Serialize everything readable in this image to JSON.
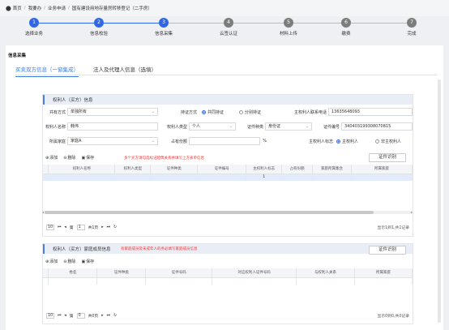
{
  "breadcrumb": {
    "items": [
      "首页",
      "我要办",
      "业务申请",
      "国有建设用地存量房转移登记（二手房）"
    ]
  },
  "steps": [
    {
      "num": "1",
      "label": "选择业务",
      "state": "active"
    },
    {
      "num": "2",
      "label": "信息校验",
      "state": "active"
    },
    {
      "num": "3",
      "label": "信息采集",
      "state": "active"
    },
    {
      "num": "4",
      "label": "云签认证",
      "state": "todo"
    },
    {
      "num": "5",
      "label": "材料上传",
      "state": "todo"
    },
    {
      "num": "6",
      "label": "缴费",
      "state": "todo"
    },
    {
      "num": "7",
      "label": "完成",
      "state": "todo"
    }
  ],
  "section_title": "信息采集",
  "tabs": [
    "买卖双方信息（一窗集成）",
    "法人及代理人信息（选填）"
  ],
  "rights_panel": {
    "title": "权利人（买方）信息",
    "fields": {
      "gongyou_label": "共有方式",
      "gongyou_value": "单独所有",
      "biaoding_label": "持证方式",
      "biaoding_opt1": "共同持证",
      "biaoding_opt2": "分别持证",
      "phone_label": "主权利人联系电话",
      "phone_value": "13635648093",
      "name_label": "权利人名称",
      "name_value": "韩伟",
      "type_label": "权利人类型",
      "type_value": "个人",
      "idtype_label": "证件种类",
      "idtype_value": "身份证",
      "idnum_label": "证件编号",
      "idnum_value": "340403199308070815",
      "area_label": "所属家庭",
      "area_value": "家庭A",
      "share_label": "占有份额",
      "share_value": "",
      "share_unit": "%",
      "main_label": "主权利人标志",
      "main_opt1": "主权利人",
      "main_opt2": "非主权利人"
    },
    "toolbar": {
      "add": "添加",
      "delete": "删除",
      "save": "保存"
    },
    "hint": "多个买方请勾选标记配偶关系并填写上方表单信息",
    "id_button": "证件识别",
    "columns": [
      "权利人名称",
      "权利人类型",
      "证件种类",
      "证件编号",
      "主权利人标志",
      "占有份额",
      "家庭所属集合",
      "所属家庭"
    ],
    "rows": [
      [
        "",
        "",
        "",
        "",
        "1",
        "",
        "",
        ""
      ]
    ],
    "pager": {
      "size": "10",
      "page": "1",
      "total_pages": "共1页",
      "info": "显示1到1,共1记录"
    }
  },
  "family_panel": {
    "title": "权利人（买方）家庭成员信息",
    "hint": "有家庭成员及未成年人的务必填写家庭成员信息",
    "toolbar": {
      "add": "添加",
      "delete": "删除",
      "save": "保存"
    },
    "id_button": "证件识别",
    "columns": [
      "姓名",
      "证件种类",
      "证件号码",
      "对应权利人证件号码",
      "与权利人关系",
      "所属家庭"
    ],
    "pager": {
      "size": "10",
      "page": "0",
      "total_pages": "共0页",
      "info": "显示0到0,共0记录"
    }
  },
  "colors": {
    "accent": "#2f67e6",
    "inactive": "#7d7d7d",
    "hint": "#e33333"
  }
}
